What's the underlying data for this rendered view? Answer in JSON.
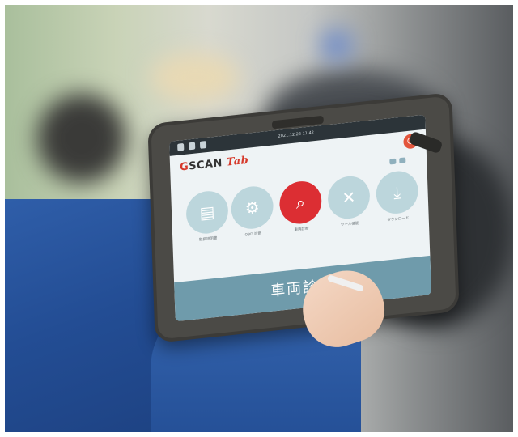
{
  "screen": {
    "status_time": "2021.12.23 11:42",
    "logo_prefix": "G",
    "logo_middle": "SCAN",
    "logo_suffix": "Tab",
    "power_icon": "power-icon",
    "menu": [
      {
        "name": "user-manual",
        "icon": "document-icon",
        "label": "取扱説明書"
      },
      {
        "name": "obd",
        "icon": "engine-icon",
        "label": "OBD 診断"
      },
      {
        "name": "vehicle-diagnosis",
        "icon": "car-scan-icon",
        "label": "車両診断"
      },
      {
        "name": "tools",
        "icon": "wrench-screwdriver-icon",
        "label": "ツール機能"
      },
      {
        "name": "download",
        "icon": "download-icon",
        "label": "ダウンロード"
      }
    ],
    "banner": "車両診断"
  }
}
